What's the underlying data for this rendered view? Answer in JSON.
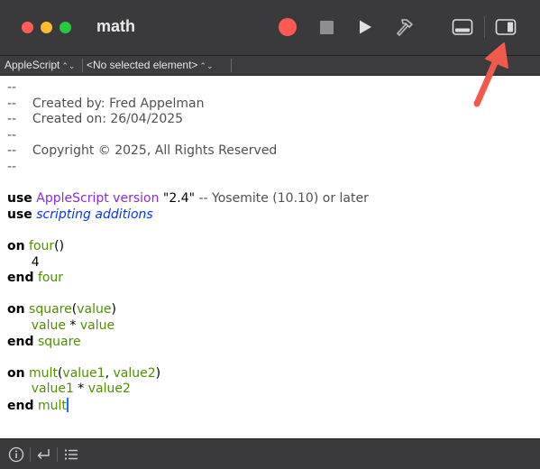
{
  "window": {
    "title": "math"
  },
  "toolbar": {
    "record": "record-button",
    "stop": "stop-button",
    "run": "run-button",
    "compile": "compile-button",
    "show_log": "show-log-button",
    "show_sidebar": "show-sidebar-button"
  },
  "navigator": {
    "language": "AppleScript",
    "element": "<No selected element>"
  },
  "editor": {
    "lines": [
      {
        "parts": [
          {
            "t": "--",
            "c": "cmt"
          }
        ]
      },
      {
        "parts": [
          {
            "t": "--    Created by: Fred Appelman",
            "c": "cmt"
          }
        ]
      },
      {
        "parts": [
          {
            "t": "--    Created on: 26/04/2025",
            "c": "cmt"
          }
        ]
      },
      {
        "parts": [
          {
            "t": "--",
            "c": "cmt"
          }
        ]
      },
      {
        "parts": [
          {
            "t": "--    Copyright © 2025, All Rights Reserved",
            "c": "cmt"
          }
        ]
      },
      {
        "parts": [
          {
            "t": "--",
            "c": "cmt"
          }
        ]
      },
      {
        "parts": []
      },
      {
        "parts": [
          {
            "t": "use",
            "c": "kw"
          },
          {
            "t": " ",
            "c": ""
          },
          {
            "t": "AppleScript",
            "c": "cls"
          },
          {
            "t": " ",
            "c": ""
          },
          {
            "t": "version",
            "c": "cls"
          },
          {
            "t": " \"2.4\"",
            "c": "str"
          },
          {
            "t": " -- Yosemite (10.10) or later",
            "c": "cmt"
          }
        ]
      },
      {
        "parts": [
          {
            "t": "use",
            "c": "kw"
          },
          {
            "t": " ",
            "c": ""
          },
          {
            "t": "scripting additions",
            "c": "sa"
          }
        ]
      },
      {
        "parts": []
      },
      {
        "parts": [
          {
            "t": "on",
            "c": "kw"
          },
          {
            "t": " ",
            "c": ""
          },
          {
            "t": "four",
            "c": "hn"
          },
          {
            "t": "()",
            "c": ""
          }
        ]
      },
      {
        "parts": [
          {
            "t": "      4",
            "c": ""
          }
        ]
      },
      {
        "parts": [
          {
            "t": "end",
            "c": "kw"
          },
          {
            "t": " ",
            "c": ""
          },
          {
            "t": "four",
            "c": "hn"
          }
        ]
      },
      {
        "parts": []
      },
      {
        "parts": [
          {
            "t": "on",
            "c": "kw"
          },
          {
            "t": " ",
            "c": ""
          },
          {
            "t": "square",
            "c": "hn"
          },
          {
            "t": "(",
            "c": ""
          },
          {
            "t": "value",
            "c": "hn"
          },
          {
            "t": ")",
            "c": ""
          }
        ]
      },
      {
        "parts": [
          {
            "t": "      ",
            "c": ""
          },
          {
            "t": "value",
            "c": "hn"
          },
          {
            "t": " * ",
            "c": ""
          },
          {
            "t": "value",
            "c": "hn"
          }
        ]
      },
      {
        "parts": [
          {
            "t": "end",
            "c": "kw"
          },
          {
            "t": " ",
            "c": ""
          },
          {
            "t": "square",
            "c": "hn"
          }
        ]
      },
      {
        "parts": []
      },
      {
        "parts": [
          {
            "t": "on",
            "c": "kw"
          },
          {
            "t": " ",
            "c": ""
          },
          {
            "t": "mult",
            "c": "hn"
          },
          {
            "t": "(",
            "c": ""
          },
          {
            "t": "value1",
            "c": "hn"
          },
          {
            "t": ", ",
            "c": ""
          },
          {
            "t": "value2",
            "c": "hn"
          },
          {
            "t": ")",
            "c": ""
          }
        ]
      },
      {
        "parts": [
          {
            "t": "      ",
            "c": ""
          },
          {
            "t": "value1",
            "c": "hn"
          },
          {
            "t": " * ",
            "c": ""
          },
          {
            "t": "value2",
            "c": "hn"
          }
        ]
      },
      {
        "parts": [
          {
            "t": "end",
            "c": "kw"
          },
          {
            "t": " ",
            "c": ""
          },
          {
            "t": "mult",
            "c": "hn"
          }
        ],
        "caret": true
      }
    ]
  },
  "bottom": {
    "info": "info-icon",
    "reply": "return-icon",
    "list": "list-icon"
  },
  "colors": {
    "close": "#ff5f57",
    "minimize": "#febc2e",
    "zoom": "#28c840",
    "record": "#ff5a52",
    "annotation_arrow": "#f05a4b",
    "handler": "#4f8f00",
    "class": "#8a2be2",
    "scripting_additions": "#0433ff"
  }
}
